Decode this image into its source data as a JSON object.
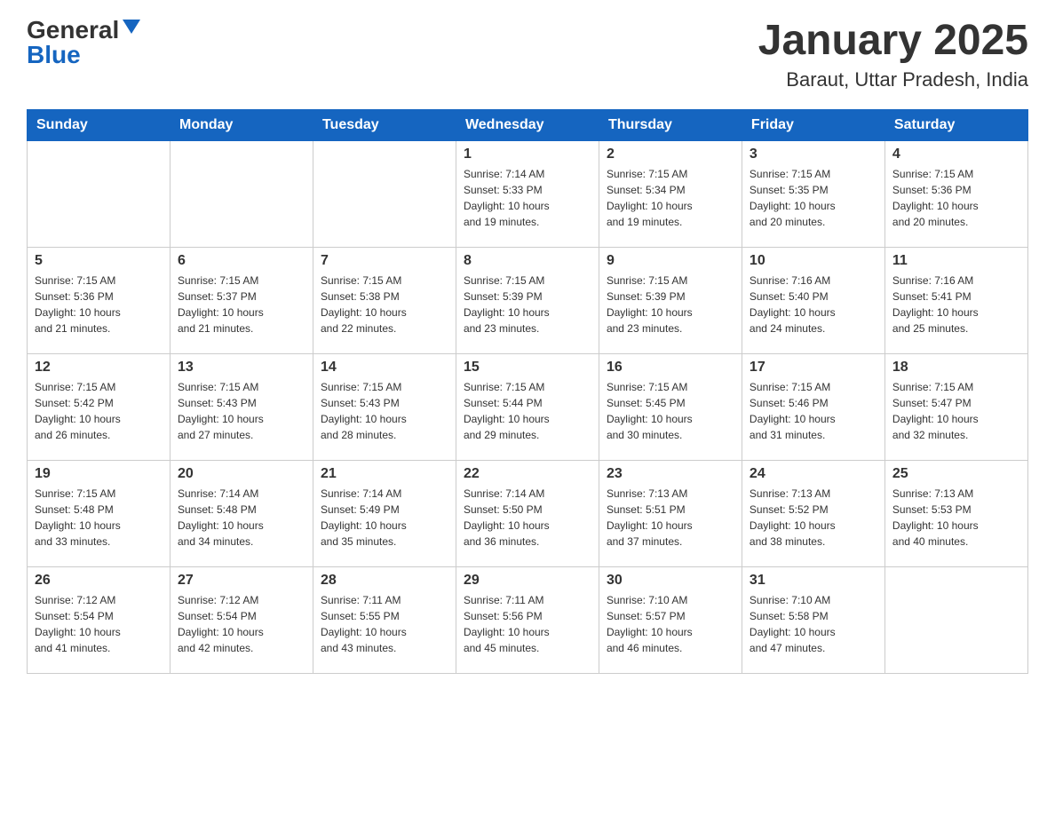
{
  "header": {
    "logo_general": "General",
    "logo_blue": "Blue",
    "month_title": "January 2025",
    "location": "Baraut, Uttar Pradesh, India"
  },
  "weekdays": [
    "Sunday",
    "Monday",
    "Tuesday",
    "Wednesday",
    "Thursday",
    "Friday",
    "Saturday"
  ],
  "weeks": [
    [
      {
        "day": "",
        "info": ""
      },
      {
        "day": "",
        "info": ""
      },
      {
        "day": "",
        "info": ""
      },
      {
        "day": "1",
        "info": "Sunrise: 7:14 AM\nSunset: 5:33 PM\nDaylight: 10 hours\nand 19 minutes."
      },
      {
        "day": "2",
        "info": "Sunrise: 7:15 AM\nSunset: 5:34 PM\nDaylight: 10 hours\nand 19 minutes."
      },
      {
        "day": "3",
        "info": "Sunrise: 7:15 AM\nSunset: 5:35 PM\nDaylight: 10 hours\nand 20 minutes."
      },
      {
        "day": "4",
        "info": "Sunrise: 7:15 AM\nSunset: 5:36 PM\nDaylight: 10 hours\nand 20 minutes."
      }
    ],
    [
      {
        "day": "5",
        "info": "Sunrise: 7:15 AM\nSunset: 5:36 PM\nDaylight: 10 hours\nand 21 minutes."
      },
      {
        "day": "6",
        "info": "Sunrise: 7:15 AM\nSunset: 5:37 PM\nDaylight: 10 hours\nand 21 minutes."
      },
      {
        "day": "7",
        "info": "Sunrise: 7:15 AM\nSunset: 5:38 PM\nDaylight: 10 hours\nand 22 minutes."
      },
      {
        "day": "8",
        "info": "Sunrise: 7:15 AM\nSunset: 5:39 PM\nDaylight: 10 hours\nand 23 minutes."
      },
      {
        "day": "9",
        "info": "Sunrise: 7:15 AM\nSunset: 5:39 PM\nDaylight: 10 hours\nand 23 minutes."
      },
      {
        "day": "10",
        "info": "Sunrise: 7:16 AM\nSunset: 5:40 PM\nDaylight: 10 hours\nand 24 minutes."
      },
      {
        "day": "11",
        "info": "Sunrise: 7:16 AM\nSunset: 5:41 PM\nDaylight: 10 hours\nand 25 minutes."
      }
    ],
    [
      {
        "day": "12",
        "info": "Sunrise: 7:15 AM\nSunset: 5:42 PM\nDaylight: 10 hours\nand 26 minutes."
      },
      {
        "day": "13",
        "info": "Sunrise: 7:15 AM\nSunset: 5:43 PM\nDaylight: 10 hours\nand 27 minutes."
      },
      {
        "day": "14",
        "info": "Sunrise: 7:15 AM\nSunset: 5:43 PM\nDaylight: 10 hours\nand 28 minutes."
      },
      {
        "day": "15",
        "info": "Sunrise: 7:15 AM\nSunset: 5:44 PM\nDaylight: 10 hours\nand 29 minutes."
      },
      {
        "day": "16",
        "info": "Sunrise: 7:15 AM\nSunset: 5:45 PM\nDaylight: 10 hours\nand 30 minutes."
      },
      {
        "day": "17",
        "info": "Sunrise: 7:15 AM\nSunset: 5:46 PM\nDaylight: 10 hours\nand 31 minutes."
      },
      {
        "day": "18",
        "info": "Sunrise: 7:15 AM\nSunset: 5:47 PM\nDaylight: 10 hours\nand 32 minutes."
      }
    ],
    [
      {
        "day": "19",
        "info": "Sunrise: 7:15 AM\nSunset: 5:48 PM\nDaylight: 10 hours\nand 33 minutes."
      },
      {
        "day": "20",
        "info": "Sunrise: 7:14 AM\nSunset: 5:48 PM\nDaylight: 10 hours\nand 34 minutes."
      },
      {
        "day": "21",
        "info": "Sunrise: 7:14 AM\nSunset: 5:49 PM\nDaylight: 10 hours\nand 35 minutes."
      },
      {
        "day": "22",
        "info": "Sunrise: 7:14 AM\nSunset: 5:50 PM\nDaylight: 10 hours\nand 36 minutes."
      },
      {
        "day": "23",
        "info": "Sunrise: 7:13 AM\nSunset: 5:51 PM\nDaylight: 10 hours\nand 37 minutes."
      },
      {
        "day": "24",
        "info": "Sunrise: 7:13 AM\nSunset: 5:52 PM\nDaylight: 10 hours\nand 38 minutes."
      },
      {
        "day": "25",
        "info": "Sunrise: 7:13 AM\nSunset: 5:53 PM\nDaylight: 10 hours\nand 40 minutes."
      }
    ],
    [
      {
        "day": "26",
        "info": "Sunrise: 7:12 AM\nSunset: 5:54 PM\nDaylight: 10 hours\nand 41 minutes."
      },
      {
        "day": "27",
        "info": "Sunrise: 7:12 AM\nSunset: 5:54 PM\nDaylight: 10 hours\nand 42 minutes."
      },
      {
        "day": "28",
        "info": "Sunrise: 7:11 AM\nSunset: 5:55 PM\nDaylight: 10 hours\nand 43 minutes."
      },
      {
        "day": "29",
        "info": "Sunrise: 7:11 AM\nSunset: 5:56 PM\nDaylight: 10 hours\nand 45 minutes."
      },
      {
        "day": "30",
        "info": "Sunrise: 7:10 AM\nSunset: 5:57 PM\nDaylight: 10 hours\nand 46 minutes."
      },
      {
        "day": "31",
        "info": "Sunrise: 7:10 AM\nSunset: 5:58 PM\nDaylight: 10 hours\nand 47 minutes."
      },
      {
        "day": "",
        "info": ""
      }
    ]
  ]
}
